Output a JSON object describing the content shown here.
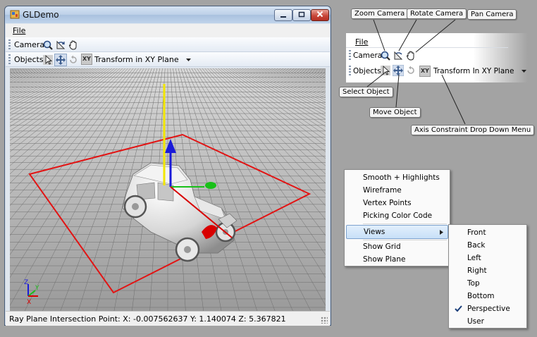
{
  "window": {
    "title": "GLDemo",
    "menu_file": "File",
    "camera_label": "Camera",
    "objects_label": "Objects",
    "axis_badge": "XY",
    "constraint": "Transform in XY Plane",
    "status": "Ray Plane Intersection Point:  X: -0.007562637   Y: 1.140074   Z: 5.367821"
  },
  "detail": {
    "menu_file": "File",
    "camera_label": "Camera",
    "objects_label": "Objects",
    "axis_badge": "XY",
    "constraint": "Transform In XY Plane"
  },
  "callouts": {
    "zoom": "Zoom Camera",
    "rotate": "Rotate Camera",
    "pan": "Pan Camera",
    "select": "Select Object",
    "move": "Move Object",
    "axis": "Axis Constraint Drop Down Menu"
  },
  "context_menu": {
    "items": [
      "Smooth + Highlights",
      "Wireframe",
      "Vertex Points",
      "Picking Color Code",
      "Views",
      "Show Grid",
      "Show Plane"
    ],
    "highlighted": "Views"
  },
  "views_menu": {
    "items": [
      "Front",
      "Back",
      "Left",
      "Right",
      "Top",
      "Bottom",
      "Perspective",
      "User"
    ],
    "checked": "Perspective"
  },
  "gizmo": {
    "x": "X",
    "y": "Y",
    "z": "Z"
  },
  "colors": {
    "grid_line": "#6e6e6e",
    "plane_outline": "#e21414",
    "axis_y": "#f2e600",
    "axis_up": "#1a1ad8",
    "axis_x": "#d80000",
    "axis_green": "#19c019",
    "menu_highlight": "#c8e0f8"
  }
}
